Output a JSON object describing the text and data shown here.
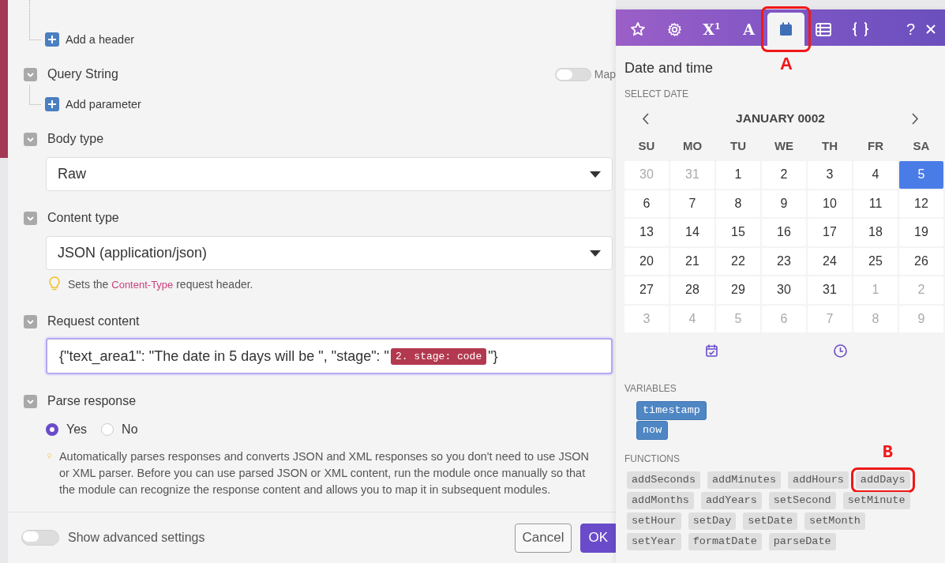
{
  "form": {
    "headers": {
      "add_label": "Add a header"
    },
    "query_string": {
      "label": "Query String",
      "map_toggle": {
        "label": "Map",
        "on": false
      },
      "add_label": "Add parameter"
    },
    "body_type": {
      "label": "Body type",
      "value": "Raw"
    },
    "content_type": {
      "label": "Content type",
      "value": "JSON (application/json)",
      "hint": [
        {
          "kind": "text",
          "text": "Sets the "
        },
        {
          "kind": "code",
          "text": "Content-Type"
        },
        {
          "kind": "text",
          "text": " request header."
        }
      ]
    },
    "request_content": {
      "label": "Request content",
      "focused": true,
      "parts": [
        {
          "kind": "text",
          "text": "{\"text_area1\": \"The date in 5 days will be \", \"stage\": \""
        },
        {
          "kind": "token",
          "text": "2. stage: code"
        },
        {
          "kind": "text",
          "text": "\"}"
        }
      ]
    },
    "parse_response": {
      "label": "Parse response",
      "options": [
        {
          "label": "Yes",
          "selected": true
        },
        {
          "label": "No",
          "selected": false
        }
      ],
      "hint": "Automatically parses responses and converts JSON and XML responses so you don't need to use JSON or XML parser. Before you can use parsed JSON or XML content, run the module once manually so that the module can recognize the response content and allows you to map it in subsequent modules."
    }
  },
  "footer": {
    "advanced_toggle": {
      "label": "Show advanced settings",
      "on": false
    },
    "buttons": [
      {
        "label": "Cancel",
        "kind": "secondary"
      },
      {
        "label": "OK",
        "kind": "primary"
      }
    ]
  },
  "picker": {
    "tabs": [
      {
        "kind": "star",
        "selected": false
      },
      {
        "kind": "gear",
        "selected": false
      },
      {
        "kind": "text",
        "label": "X$^{1}$",
        "selected": false
      },
      {
        "kind": "text",
        "label": "A",
        "selected": false
      },
      {
        "kind": "calendar",
        "selected": true,
        "annotation": "A"
      },
      {
        "kind": "table",
        "selected": false
      },
      {
        "kind": "braces",
        "selected": false
      }
    ],
    "help_label": "?",
    "title": "Date and time",
    "select_date_label": "SELECT DATE",
    "month": "JANUARY 0002",
    "weekdays": [
      "SU",
      "MO",
      "TU",
      "WE",
      "TH",
      "FR",
      "SA"
    ],
    "days": [
      {
        "label": "30",
        "outside": true,
        "selected": false
      },
      {
        "label": "31",
        "outside": true,
        "selected": false
      },
      {
        "label": "1",
        "outside": false,
        "selected": false
      },
      {
        "label": "2",
        "outside": false,
        "selected": false
      },
      {
        "label": "3",
        "outside": false,
        "selected": false
      },
      {
        "label": "4",
        "outside": false,
        "selected": false
      },
      {
        "label": "5",
        "outside": false,
        "selected": true
      },
      {
        "label": "6",
        "outside": false,
        "selected": false
      },
      {
        "label": "7",
        "outside": false,
        "selected": false
      },
      {
        "label": "8",
        "outside": false,
        "selected": false
      },
      {
        "label": "9",
        "outside": false,
        "selected": false
      },
      {
        "label": "10",
        "outside": false,
        "selected": false
      },
      {
        "label": "11",
        "outside": false,
        "selected": false
      },
      {
        "label": "12",
        "outside": false,
        "selected": false
      },
      {
        "label": "13",
        "outside": false,
        "selected": false
      },
      {
        "label": "14",
        "outside": false,
        "selected": false
      },
      {
        "label": "15",
        "outside": false,
        "selected": false
      },
      {
        "label": "16",
        "outside": false,
        "selected": false
      },
      {
        "label": "17",
        "outside": false,
        "selected": false
      },
      {
        "label": "18",
        "outside": false,
        "selected": false
      },
      {
        "label": "19",
        "outside": false,
        "selected": false
      },
      {
        "label": "20",
        "outside": false,
        "selected": false
      },
      {
        "label": "21",
        "outside": false,
        "selected": false
      },
      {
        "label": "22",
        "outside": false,
        "selected": false
      },
      {
        "label": "23",
        "outside": false,
        "selected": false
      },
      {
        "label": "24",
        "outside": false,
        "selected": false
      },
      {
        "label": "25",
        "outside": false,
        "selected": false
      },
      {
        "label": "26",
        "outside": false,
        "selected": false
      },
      {
        "label": "27",
        "outside": false,
        "selected": false
      },
      {
        "label": "28",
        "outside": false,
        "selected": false
      },
      {
        "label": "29",
        "outside": false,
        "selected": false
      },
      {
        "label": "30",
        "outside": false,
        "selected": false
      },
      {
        "label": "31",
        "outside": false,
        "selected": false
      },
      {
        "label": "1",
        "outside": true,
        "selected": false
      },
      {
        "label": "2",
        "outside": true,
        "selected": false
      },
      {
        "label": "3",
        "outside": true,
        "selected": false
      },
      {
        "label": "4",
        "outside": true,
        "selected": false
      },
      {
        "label": "5",
        "outside": true,
        "selected": false
      },
      {
        "label": "6",
        "outside": true,
        "selected": false
      },
      {
        "label": "7",
        "outside": true,
        "selected": false
      },
      {
        "label": "8",
        "outside": true,
        "selected": false
      },
      {
        "label": "9",
        "outside": true,
        "selected": false
      }
    ],
    "variables_label": "VARIABLES",
    "variables": [
      "timestamp",
      "now"
    ],
    "functions_label": "FUNCTIONS",
    "functions": [
      {
        "label": "addSeconds"
      },
      {
        "label": "addMinutes"
      },
      {
        "label": "addHours"
      },
      {
        "label": "addDays",
        "annotation": "B"
      },
      {
        "label": "addMonths"
      },
      {
        "label": "addYears"
      },
      {
        "label": "setSecond"
      },
      {
        "label": "setMinute"
      },
      {
        "label": "setHour"
      },
      {
        "label": "setDay"
      },
      {
        "label": "setDate"
      },
      {
        "label": "setMonth"
      },
      {
        "label": "setYear"
      },
      {
        "label": "formatDate"
      },
      {
        "label": "parseDate"
      }
    ]
  }
}
